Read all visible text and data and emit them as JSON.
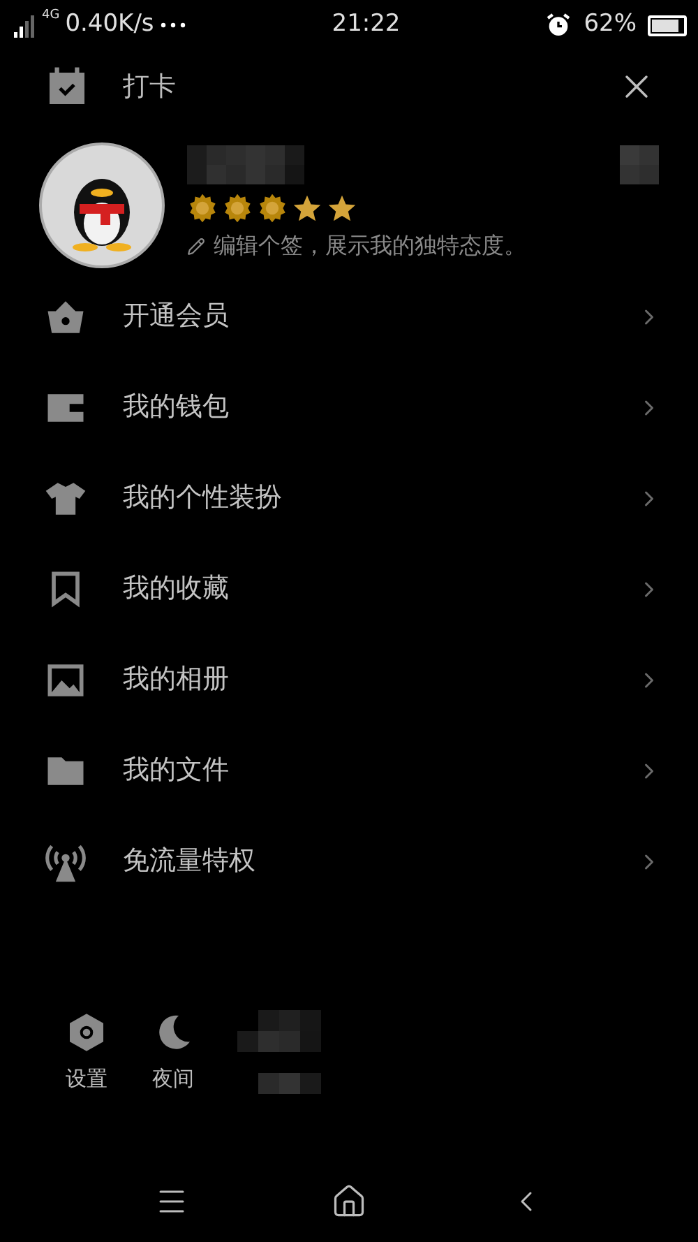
{
  "status_bar": {
    "network": "4G",
    "speed": "0.40K/s",
    "time": "21:22",
    "battery": "62%"
  },
  "header": {
    "checkin_label": "打卡"
  },
  "profile": {
    "badges": [
      {
        "kind": "sun"
      },
      {
        "kind": "sun"
      },
      {
        "kind": "sun"
      },
      {
        "kind": "star"
      },
      {
        "kind": "star"
      }
    ],
    "signature": "编辑个签，展示我的独特态度。"
  },
  "menu": [
    {
      "kind": "vip",
      "label": "开通会员"
    },
    {
      "kind": "wallet",
      "label": "我的钱包"
    },
    {
      "kind": "shirt",
      "label": "我的个性装扮"
    },
    {
      "kind": "bookmark",
      "label": "我的收藏"
    },
    {
      "kind": "photo",
      "label": "我的相册"
    },
    {
      "kind": "folder",
      "label": "我的文件"
    },
    {
      "kind": "signal",
      "label": "免流量特权"
    }
  ],
  "bottom_actions": [
    {
      "kind": "settings",
      "label": "设置"
    },
    {
      "kind": "night",
      "label": "夜间"
    }
  ]
}
